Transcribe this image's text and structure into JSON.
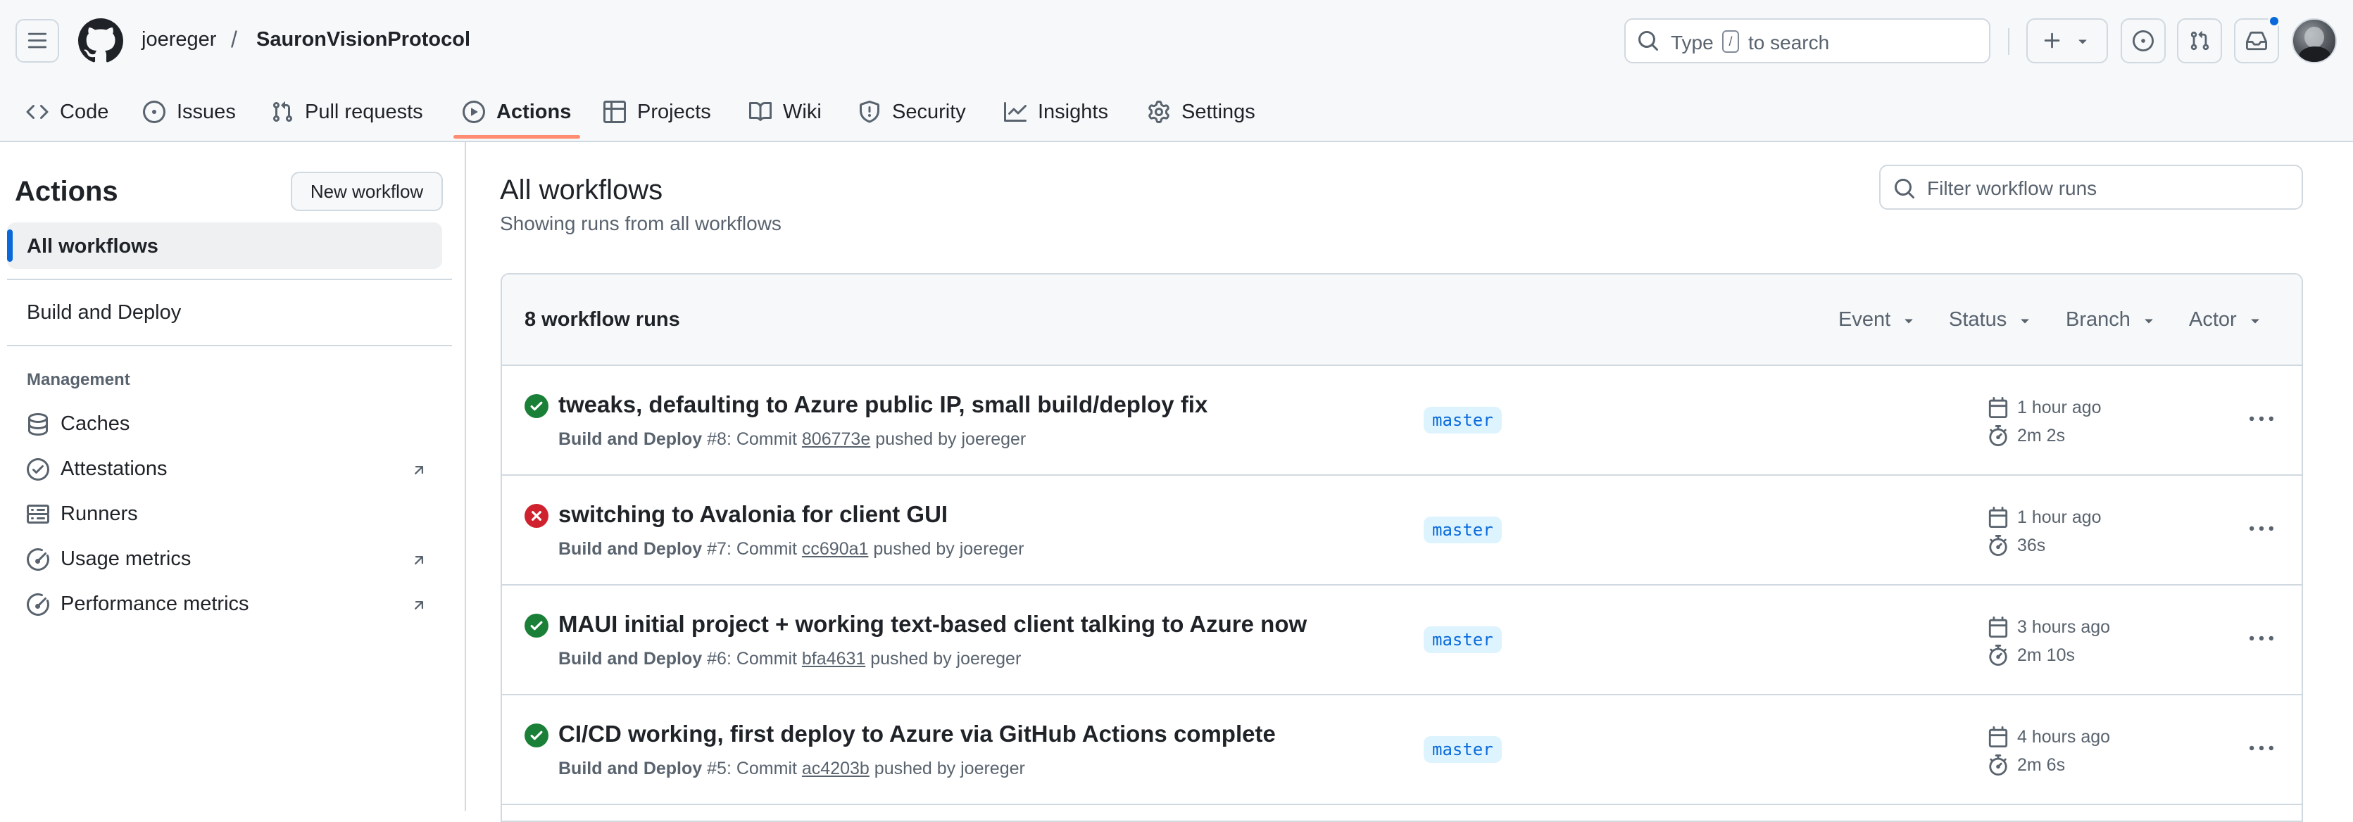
{
  "header": {
    "owner": "joereger",
    "separator": "/",
    "repo": "SauronVisionProtocol",
    "search_type": "Type",
    "search_key": "/",
    "search_rest": "to search"
  },
  "tabs": [
    {
      "label": "Code",
      "icon": "code-icon"
    },
    {
      "label": "Issues",
      "icon": "issue-icon"
    },
    {
      "label": "Pull requests",
      "icon": "pull-request-icon"
    },
    {
      "label": "Actions",
      "icon": "play-icon",
      "active": true
    },
    {
      "label": "Projects",
      "icon": "table-icon"
    },
    {
      "label": "Wiki",
      "icon": "book-icon"
    },
    {
      "label": "Security",
      "icon": "shield-icon"
    },
    {
      "label": "Insights",
      "icon": "graph-icon"
    },
    {
      "label": "Settings",
      "icon": "gear-icon"
    }
  ],
  "sidebar": {
    "title": "Actions",
    "new_workflow": "New workflow",
    "all_workflows": "All workflows",
    "workflows": [
      "Build and Deploy"
    ],
    "group_label": "Management",
    "management": [
      {
        "label": "Caches",
        "icon": "database-icon",
        "external": false
      },
      {
        "label": "Attestations",
        "icon": "check-circle-icon",
        "external": true
      },
      {
        "label": "Runners",
        "icon": "server-icon",
        "external": false
      },
      {
        "label": "Usage metrics",
        "icon": "meter-icon",
        "external": true
      },
      {
        "label": "Performance metrics",
        "icon": "meter-icon",
        "external": true
      }
    ]
  },
  "main": {
    "title": "All workflows",
    "subtitle": "Showing runs from all workflows",
    "filter_placeholder": "Filter workflow runs",
    "runs_count": "8 workflow runs",
    "filters": [
      "Event",
      "Status",
      "Branch",
      "Actor"
    ]
  },
  "runs": [
    {
      "status": "success",
      "title": "tweaks, defaulting to Azure public IP, small build/deploy fix",
      "workflow": "Build and Deploy",
      "number": "#8",
      "commit_prefix": ": Commit",
      "sha": "806773e",
      "pushed_by": "pushed by joereger",
      "branch": "master",
      "when": "1 hour ago",
      "duration": "2m 2s"
    },
    {
      "status": "failure",
      "title": "switching to Avalonia for client GUI",
      "workflow": "Build and Deploy",
      "number": "#7",
      "commit_prefix": ": Commit",
      "sha": "cc690a1",
      "pushed_by": "pushed by joereger",
      "branch": "master",
      "when": "1 hour ago",
      "duration": "36s"
    },
    {
      "status": "success",
      "title": "MAUI initial project + working text-based client talking to Azure now",
      "workflow": "Build and Deploy",
      "number": "#6",
      "commit_prefix": ": Commit",
      "sha": "bfa4631",
      "pushed_by": "pushed by joereger",
      "branch": "master",
      "when": "3 hours ago",
      "duration": "2m 10s"
    },
    {
      "status": "success",
      "title": "CI/CD working, first deploy to Azure via GitHub Actions complete",
      "workflow": "Build and Deploy",
      "number": "#5",
      "commit_prefix": ": Commit",
      "sha": "ac4203b",
      "pushed_by": "pushed by joereger",
      "branch": "master",
      "when": "4 hours ago",
      "duration": "2m 6s"
    }
  ],
  "colors": {
    "accent": "#0969da",
    "success": "#1a7f37",
    "failure": "#cf222e",
    "tab_underline": "#fd8c73"
  }
}
